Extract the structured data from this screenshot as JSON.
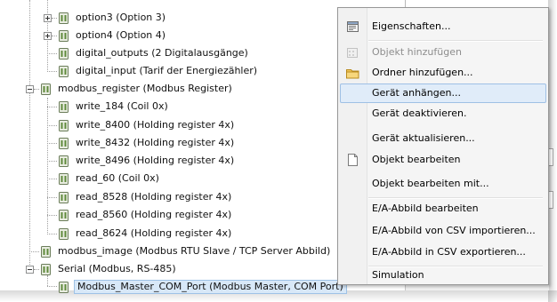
{
  "tree": {
    "items": [
      {
        "label": "option3 (Option 3)"
      },
      {
        "label": "option4 (Option 4)"
      },
      {
        "label": "digital_outputs (2 Digitalausgänge)"
      },
      {
        "label": "digital_input (Tarif der Energiezähler)"
      },
      {
        "label": "modbus_register (Modbus Register)"
      },
      {
        "label": "write_184 (Coil 0x)"
      },
      {
        "label": "write_8400 (Holding register 4x)"
      },
      {
        "label": "write_8432 (Holding register 4x)"
      },
      {
        "label": "write_8496 (Holding register 4x)"
      },
      {
        "label": "read_60 (Coil 0x)"
      },
      {
        "label": "read_8528 (Holding register 4x)"
      },
      {
        "label": "read_8560 (Holding register 4x)"
      },
      {
        "label": "read_8624 (Holding register 4x)"
      },
      {
        "label": "modbus_image (Modbus RTU Slave / TCP Server Abbild)"
      },
      {
        "label": "Serial (Modbus, RS-485)"
      },
      {
        "label": "Modbus_Master_COM_Port (Modbus Master, COM Port)"
      }
    ]
  },
  "context_menu": {
    "items": [
      {
        "label": "Eigenschaften...",
        "icon": "properties-icon"
      },
      {
        "label": "Objekt hinzufügen",
        "icon": "add-object-icon"
      },
      {
        "label": "Ordner hinzufügen...",
        "icon": "folder-icon"
      },
      {
        "label": "Gerät anhängen..."
      },
      {
        "label": "Gerät deaktivieren."
      },
      {
        "label": "Gerät aktualisieren..."
      },
      {
        "label": "Objekt bearbeiten",
        "icon": "edit-object-icon"
      },
      {
        "label": "Objekt bearbeiten mit..."
      },
      {
        "label": "E/A-Abbild bearbeiten"
      },
      {
        "label": "E/A-Abbild von CSV importieren..."
      },
      {
        "label": "E/A-Abbild in CSV exportieren..."
      },
      {
        "label": "Simulation"
      }
    ]
  },
  "colors": {
    "selection": "#d8e8f8",
    "menu_hover": "#e0ecf9",
    "folder": "#f2c75a"
  }
}
